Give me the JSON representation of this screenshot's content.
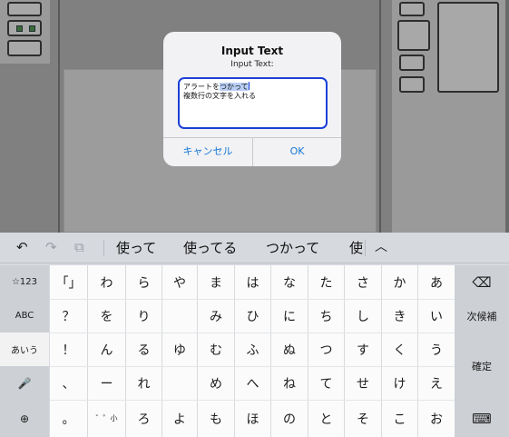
{
  "alert": {
    "title": "Input Text",
    "message": "Input Text:",
    "field": {
      "line1_prefix": "アラートを",
      "line1_selected": "つかって",
      "line2": "複数行の文字を入れる"
    },
    "cancel_label": "キャンセル",
    "ok_label": "OK"
  },
  "keyboard": {
    "predictions": [
      "使って",
      "使ってる",
      "つかって",
      "使"
    ],
    "toolbar": {
      "undo": "↶",
      "redo": "↷",
      "paste": "⧉",
      "expand": "︿"
    },
    "left_keys": [
      "☆123",
      "ABC",
      "あいう",
      "🎤",
      "⊕"
    ],
    "rows": [
      [
        "「」",
        "わ",
        "ら",
        "や",
        "ま",
        "は",
        "な",
        "た",
        "さ",
        "か",
        "あ"
      ],
      [
        "？",
        "を",
        "り",
        "",
        "み",
        "ひ",
        "に",
        "ち",
        "し",
        "き",
        "い"
      ],
      [
        "！",
        "ん",
        "る",
        "ゆ",
        "む",
        "ふ",
        "ぬ",
        "つ",
        "す",
        "く",
        "う"
      ],
      [
        "、",
        "ー",
        "れ",
        "",
        "め",
        "へ",
        "ね",
        "て",
        "せ",
        "け",
        "え"
      ],
      [
        "。",
        "゛゜小",
        "ろ",
        "よ",
        "も",
        "ほ",
        "の",
        "と",
        "そ",
        "こ",
        "お"
      ]
    ],
    "right_keys": {
      "delete": "⌫",
      "next_candidate": "次候補",
      "confirm": "確定",
      "dismiss": "⌨"
    }
  }
}
